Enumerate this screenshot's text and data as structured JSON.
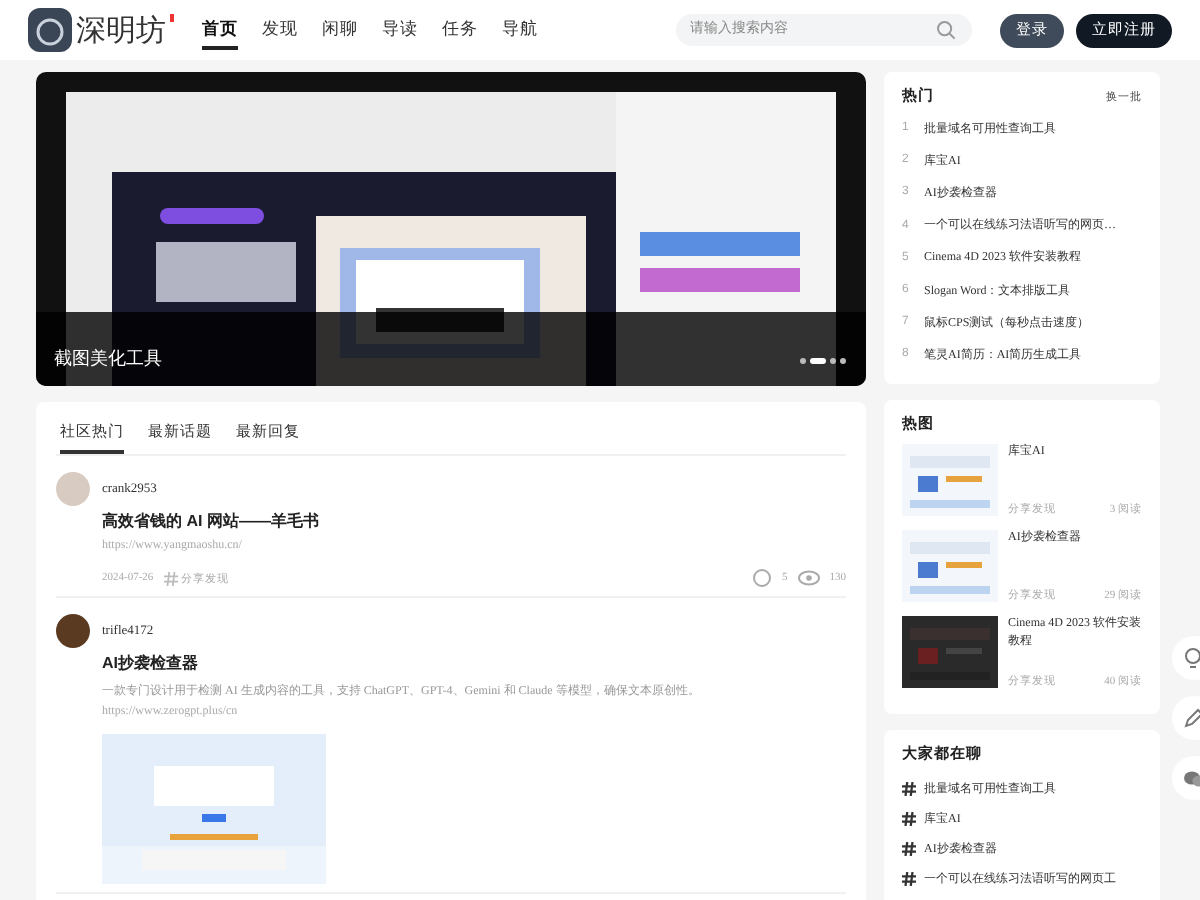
{
  "header": {
    "logo_text": "深明坊",
    "nav": [
      {
        "label": "首页",
        "selected": true
      },
      {
        "label": "发现",
        "selected": false
      },
      {
        "label": "闲聊",
        "selected": false
      },
      {
        "label": "导读",
        "selected": false
      },
      {
        "label": "任务",
        "selected": false
      },
      {
        "label": "导航",
        "selected": false
      }
    ],
    "search": {
      "placeholder": "请输入搜索内容"
    },
    "buttons": [
      {
        "label": "登录",
        "kind": "secondary"
      },
      {
        "label": "立即注册",
        "kind": "primary"
      }
    ]
  },
  "banner": {
    "caption": "截图美化工具",
    "dots": [
      {
        "selected": false
      },
      {
        "selected": true
      },
      {
        "selected": false
      },
      {
        "selected": false
      }
    ]
  },
  "feed": {
    "tabs": [
      {
        "label": "社区热门",
        "selected": true
      },
      {
        "label": "最新话题",
        "selected": false
      },
      {
        "label": "最新回复",
        "selected": false
      }
    ],
    "posts": [
      {
        "author": "crank2953",
        "title": "高效省钱的 AI 网站——羊毛书",
        "link": "https://www.yangmaoshu.cn/",
        "date": "2024-07-26",
        "category": "分享发现",
        "comments": "5",
        "views": "130"
      },
      {
        "author": "trifle4172",
        "title": "AI抄袭检查器",
        "summary": "一款专门设计用于检测 AI 生成内容的工具，支持 ChatGPT、GPT-4、Gemini 和 Claude 等模型，确保文本原创性。",
        "link": "https://www.zerogpt.plus/cn"
      }
    ]
  },
  "hot": {
    "title": "热门",
    "refresh": "换一批",
    "items": [
      {
        "rank": "1",
        "text": "批量域名可用性查询工具"
      },
      {
        "rank": "2",
        "text": "库宝AI"
      },
      {
        "rank": "3",
        "text": "AI抄袭检查器"
      },
      {
        "rank": "4",
        "text": "一个可以在线练习法语听写的网页…"
      },
      {
        "rank": "5",
        "text": "Cinema 4D 2023 软件安装教程"
      },
      {
        "rank": "6",
        "text": "Slogan Word：文本排版工具"
      },
      {
        "rank": "7",
        "text": "鼠标CPS测试（每秒点击速度）"
      },
      {
        "rank": "8",
        "text": "笔灵AI简历：AI简历生成工具"
      }
    ]
  },
  "hot_images": {
    "title": "热图",
    "items": [
      {
        "title": "库宝AI",
        "category": "分享发现",
        "reads": "3 阅读"
      },
      {
        "title": "AI抄袭检查器",
        "category": "分享发现",
        "reads": "29 阅读"
      },
      {
        "title": "Cinema 4D 2023 软件安装教程",
        "category": "分享发现",
        "reads": "40 阅读"
      }
    ]
  },
  "chatting": {
    "title": "大家都在聊",
    "items": [
      "批量域名可用性查询工具",
      "库宝AI",
      "AI抄袭检查器",
      "一个可以在线练习法语听写的网页工"
    ]
  }
}
